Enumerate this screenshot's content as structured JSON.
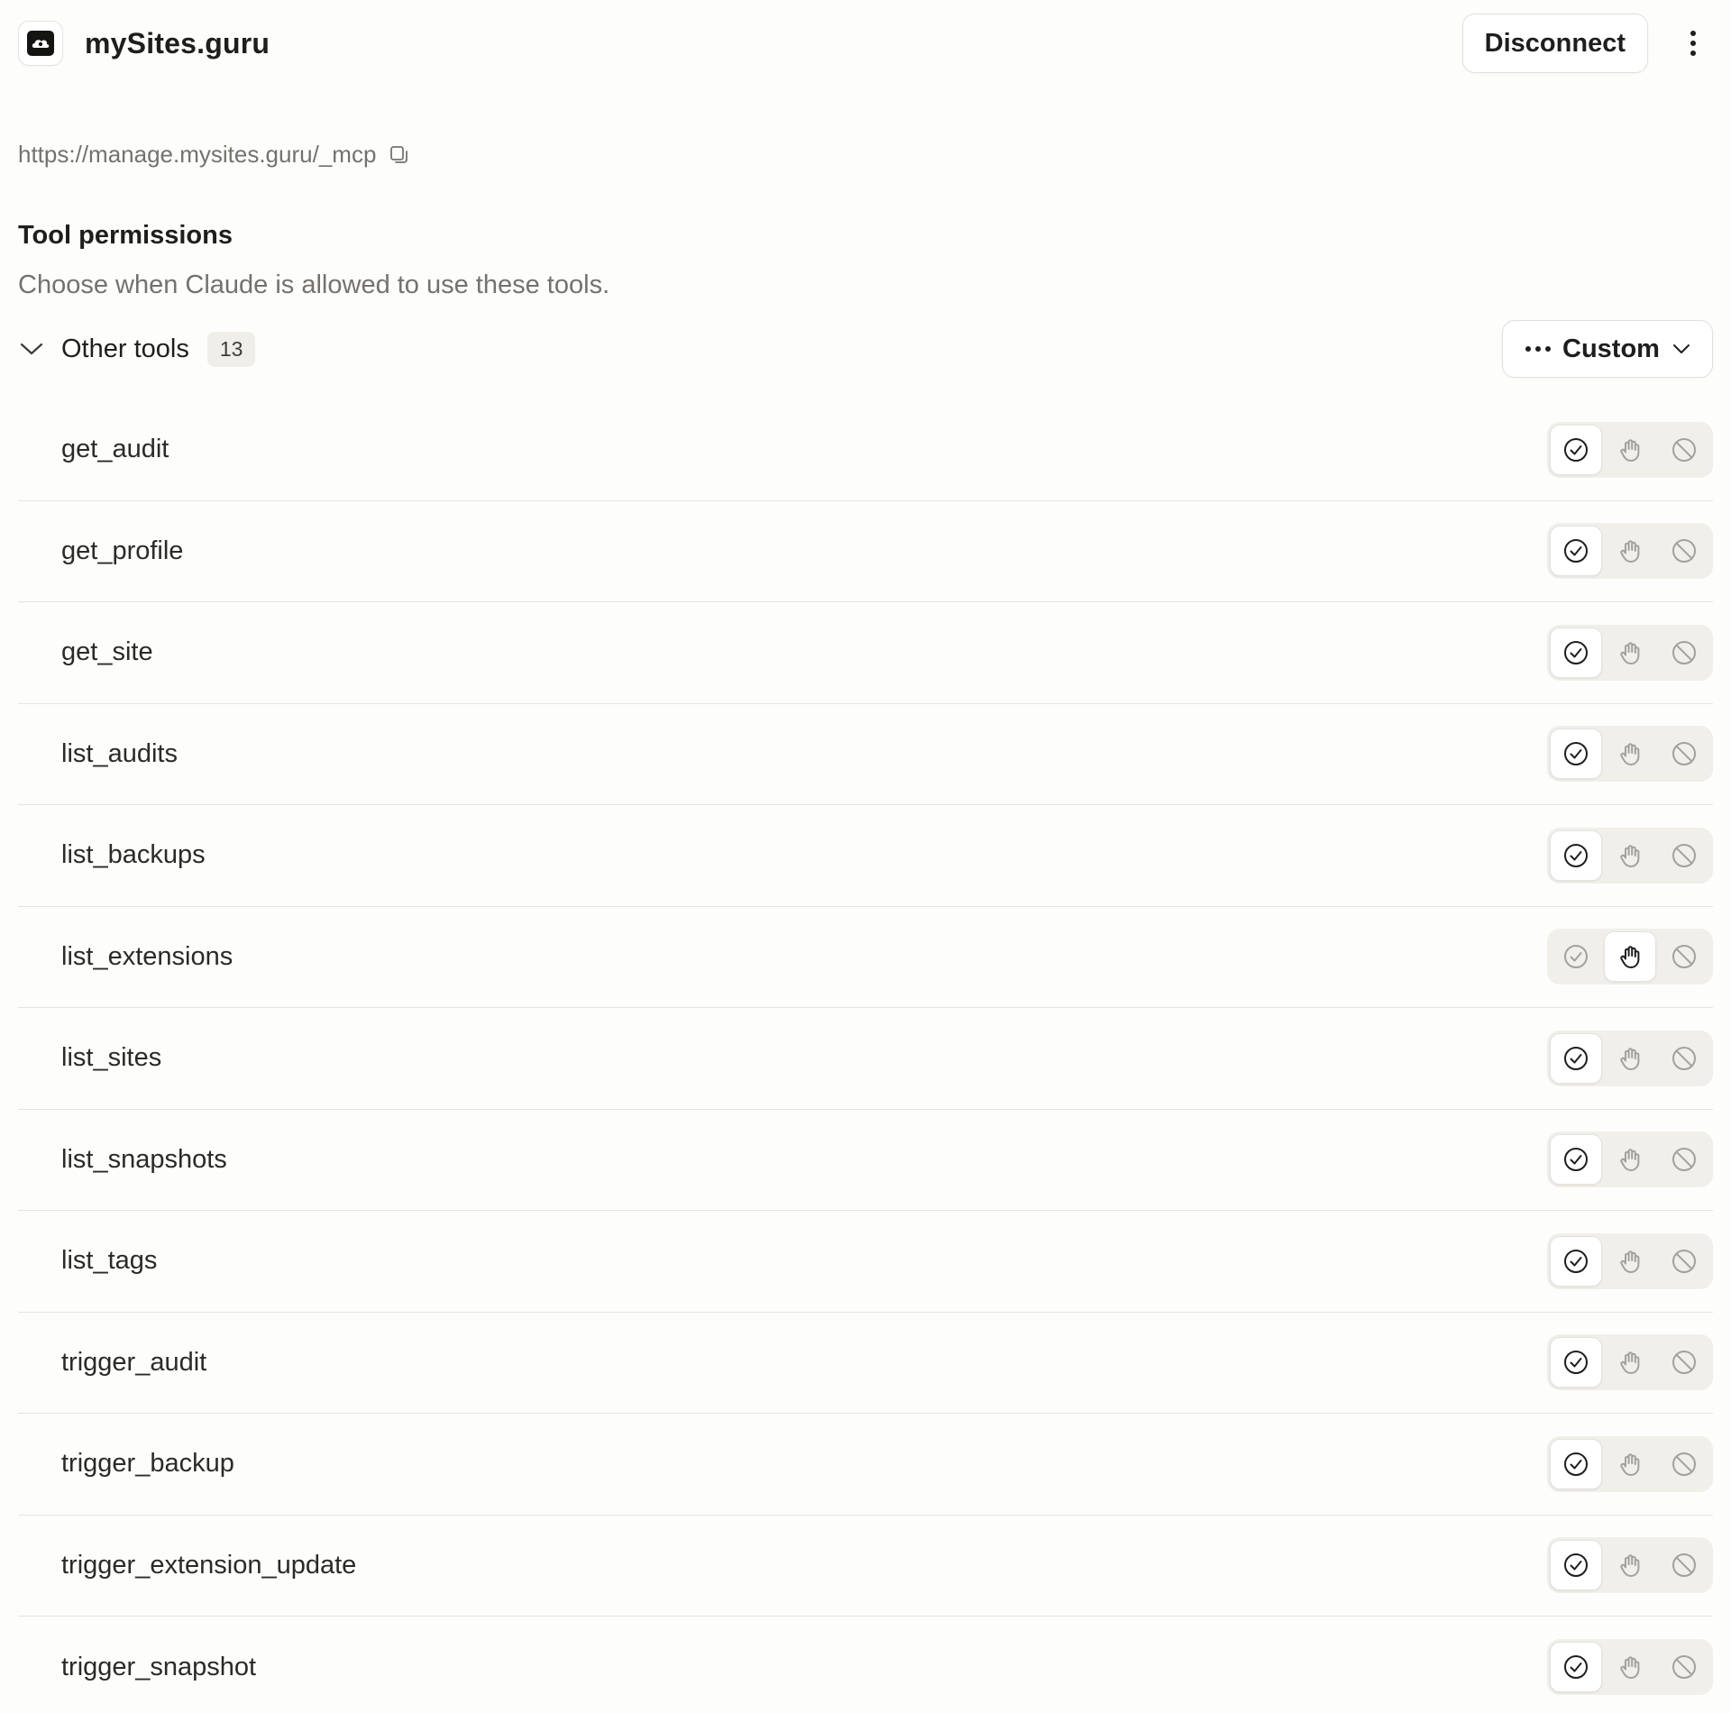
{
  "header": {
    "app_name": "mySites.guru",
    "disconnect_label": "Disconnect"
  },
  "server": {
    "url": "https://manage.mysites.guru/_mcp"
  },
  "permissions": {
    "title": "Tool permissions",
    "description": "Choose when Claude is allowed to use these tools."
  },
  "group": {
    "label": "Other tools",
    "count": "13",
    "mode_label": "Custom"
  },
  "tools": [
    {
      "name": "get_audit",
      "permission": "always_allow"
    },
    {
      "name": "get_profile",
      "permission": "always_allow"
    },
    {
      "name": "get_site",
      "permission": "always_allow"
    },
    {
      "name": "list_audits",
      "permission": "always_allow"
    },
    {
      "name": "list_backups",
      "permission": "always_allow"
    },
    {
      "name": "list_extensions",
      "permission": "needs_approval"
    },
    {
      "name": "list_sites",
      "permission": "always_allow"
    },
    {
      "name": "list_snapshots",
      "permission": "always_allow"
    },
    {
      "name": "list_tags",
      "permission": "always_allow"
    },
    {
      "name": "trigger_audit",
      "permission": "always_allow"
    },
    {
      "name": "trigger_backup",
      "permission": "always_allow"
    },
    {
      "name": "trigger_extension_update",
      "permission": "always_allow"
    },
    {
      "name": "trigger_snapshot",
      "permission": "always_allow"
    }
  ],
  "colors": {
    "active_icon": "#1f1e1d",
    "inactive_icon": "#a3a19b"
  }
}
